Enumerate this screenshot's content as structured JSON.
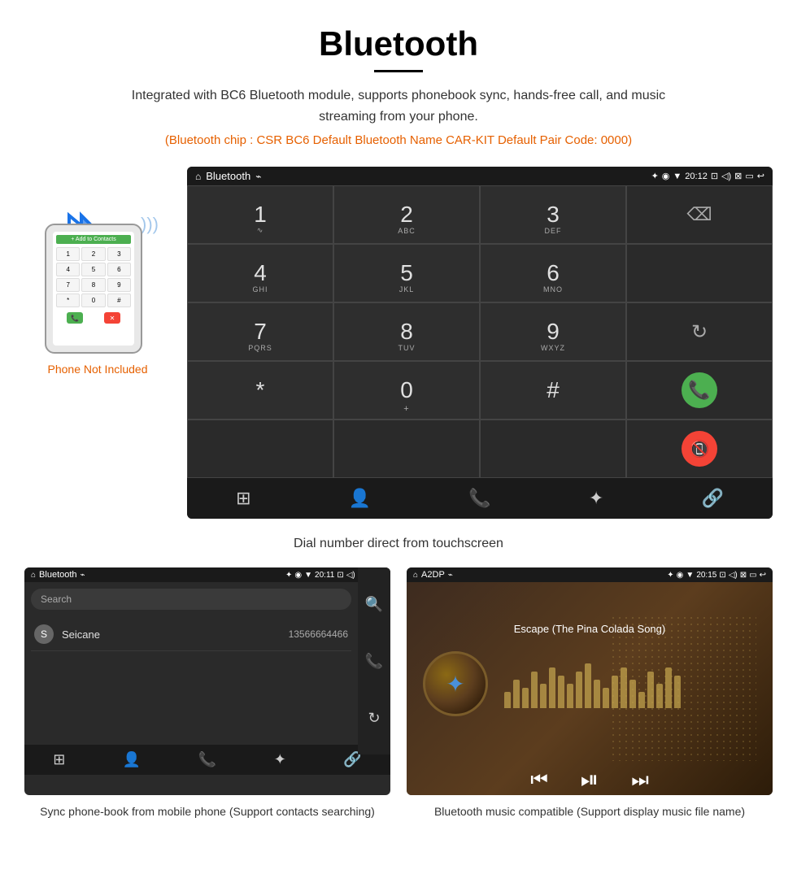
{
  "header": {
    "title": "Bluetooth",
    "description": "Integrated with BC6 Bluetooth module, supports phonebook sync, hands-free call, and music streaming from your phone.",
    "specs": "(Bluetooth chip : CSR BC6    Default Bluetooth Name CAR-KIT    Default Pair Code: 0000)"
  },
  "phone_label": "Phone Not Included",
  "dial_screen": {
    "status_bar": {
      "home_icon": "⌂",
      "title": "Bluetooth",
      "usb_icon": "⌁",
      "bluetooth_icon": "✦",
      "location_icon": "◉",
      "signal_icon": "▼",
      "time": "20:12",
      "camera_icon": "⊡",
      "volume_icon": "◁)",
      "close_icon": "⊠",
      "window_icon": "▭",
      "back_icon": "↩"
    },
    "keys": [
      {
        "number": "1",
        "letters": "∿"
      },
      {
        "number": "2",
        "letters": "ABC"
      },
      {
        "number": "3",
        "letters": "DEF"
      },
      {
        "number": "",
        "letters": "",
        "special": "backspace"
      },
      {
        "number": "4",
        "letters": "GHI"
      },
      {
        "number": "5",
        "letters": "JKL"
      },
      {
        "number": "6",
        "letters": "MNO"
      },
      {
        "number": "",
        "letters": "",
        "special": "empty"
      },
      {
        "number": "7",
        "letters": "PQRS"
      },
      {
        "number": "8",
        "letters": "TUV"
      },
      {
        "number": "9",
        "letters": "WXYZ"
      },
      {
        "number": "",
        "letters": "",
        "special": "refresh"
      },
      {
        "number": "*",
        "letters": ""
      },
      {
        "number": "0",
        "letters": "+",
        "zero": true
      },
      {
        "number": "#",
        "letters": ""
      },
      {
        "number": "",
        "letters": "",
        "special": "call-green"
      },
      {
        "number": "",
        "letters": "",
        "special": "empty"
      },
      {
        "number": "",
        "letters": "",
        "special": "empty"
      },
      {
        "number": "",
        "letters": "",
        "special": "empty"
      },
      {
        "number": "",
        "letters": "",
        "special": "call-red"
      }
    ],
    "bottom_nav_icons": [
      "⊞",
      "👤",
      "📞",
      "✦",
      "🔗"
    ]
  },
  "caption": "Dial number direct from touchscreen",
  "phonebook_screen": {
    "status_bar": {
      "title": "Bluetooth",
      "time": "20:11"
    },
    "search_placeholder": "Search",
    "contacts": [
      {
        "letter": "S",
        "name": "Seicane",
        "number": "13566664466"
      }
    ],
    "side_icons": [
      "🔍",
      "📞",
      "🔄"
    ]
  },
  "music_screen": {
    "status_bar": {
      "title": "A2DP",
      "time": "20:15"
    },
    "song_title": "Escape (The Pina Colada Song)",
    "visualizer_heights": [
      20,
      35,
      25,
      45,
      30,
      50,
      40,
      30,
      45,
      55,
      35,
      25,
      40,
      50,
      35,
      20,
      45,
      30,
      50,
      40
    ],
    "controls": {
      "prev": "⏮",
      "play_pause": "⏯",
      "next": "⏭"
    }
  },
  "bottom_captions": {
    "phonebook": "Sync phone-book from mobile phone\n(Support contacts searching)",
    "music": "Bluetooth music compatible\n(Support display music file name)"
  }
}
